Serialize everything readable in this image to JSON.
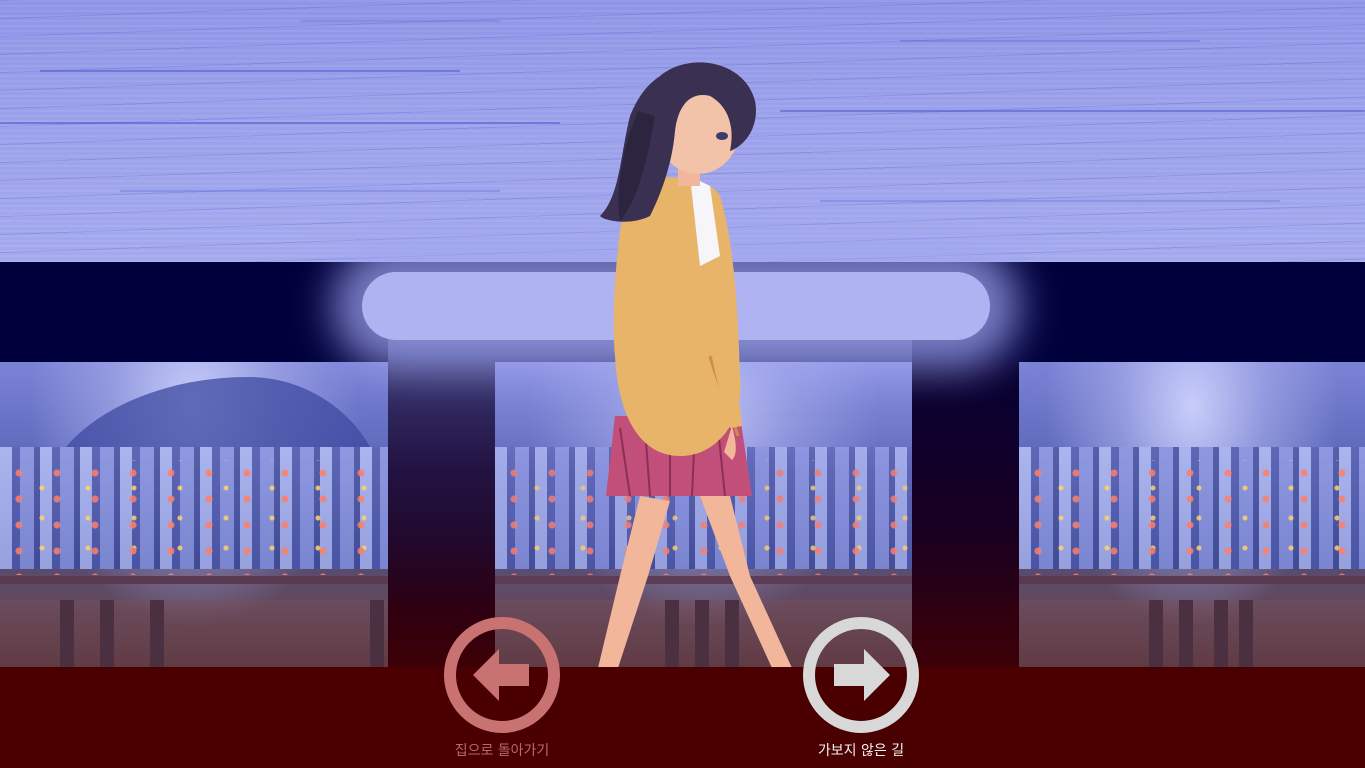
{
  "scene": {
    "character": "girl-walking-sprite"
  },
  "choices": {
    "back": {
      "label": "집으로 돌아가기",
      "icon": "arrow-left-icon",
      "color": "#c97272",
      "label_color": "#b86a6a"
    },
    "forward": {
      "label": "가보지 않은 길",
      "icon": "arrow-right-icon",
      "color": "#d8d8d8",
      "label_color": "#f2f2f2"
    }
  },
  "colors": {
    "sky": "#9aa0ea",
    "dark_band": "#00003c",
    "glow": "#b0b3f2",
    "bottom_bar": "#4a0000"
  }
}
